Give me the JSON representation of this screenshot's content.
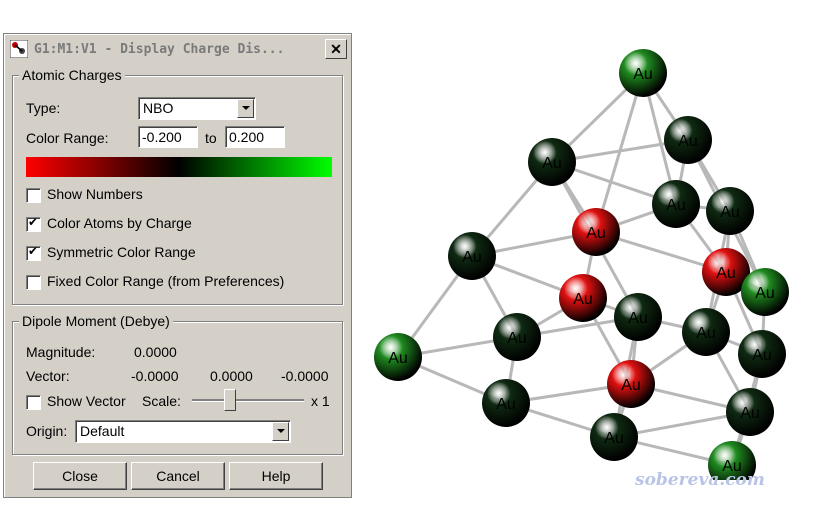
{
  "window": {
    "title": "G1:M1:V1 - Display Charge Dis...",
    "close_glyph": "✕"
  },
  "charges": {
    "group_label": "Atomic Charges",
    "type_label": "Type:",
    "type_value": "NBO",
    "range_label": "Color Range:",
    "range_min": "-0.200",
    "to_label": "to",
    "range_max": "0.200",
    "gradient_colors": [
      "#ff0000",
      "#000000",
      "#00ff00"
    ],
    "checkboxes": [
      {
        "label": "Show Numbers",
        "checked": false
      },
      {
        "label": "Color Atoms by Charge",
        "checked": true
      },
      {
        "label": "Symmetric Color Range",
        "checked": true
      },
      {
        "label": "Fixed Color Range (from Preferences)",
        "checked": false
      }
    ]
  },
  "dipole": {
    "group_label": "Dipole Moment (Debye)",
    "magnitude_label": "Magnitude:",
    "magnitude_value": "0.0000",
    "vector_label": "Vector:",
    "vector_x": "-0.0000",
    "vector_y": "0.0000",
    "vector_z": "-0.0000",
    "show_vector_label": "Show Vector",
    "show_vector_checked": false,
    "scale_label": "Scale:",
    "scale_value": "x 1",
    "origin_label": "Origin:",
    "origin_value": "Default"
  },
  "buttons": {
    "close": "Close",
    "cancel": "Cancel",
    "help": "Help"
  },
  "viewer": {
    "atom_label": "Au",
    "watermark": "sobereva.com",
    "atom_colors": {
      "red": "#e01010",
      "dark": "#0f2a12",
      "green": "#1f8a1f"
    }
  }
}
